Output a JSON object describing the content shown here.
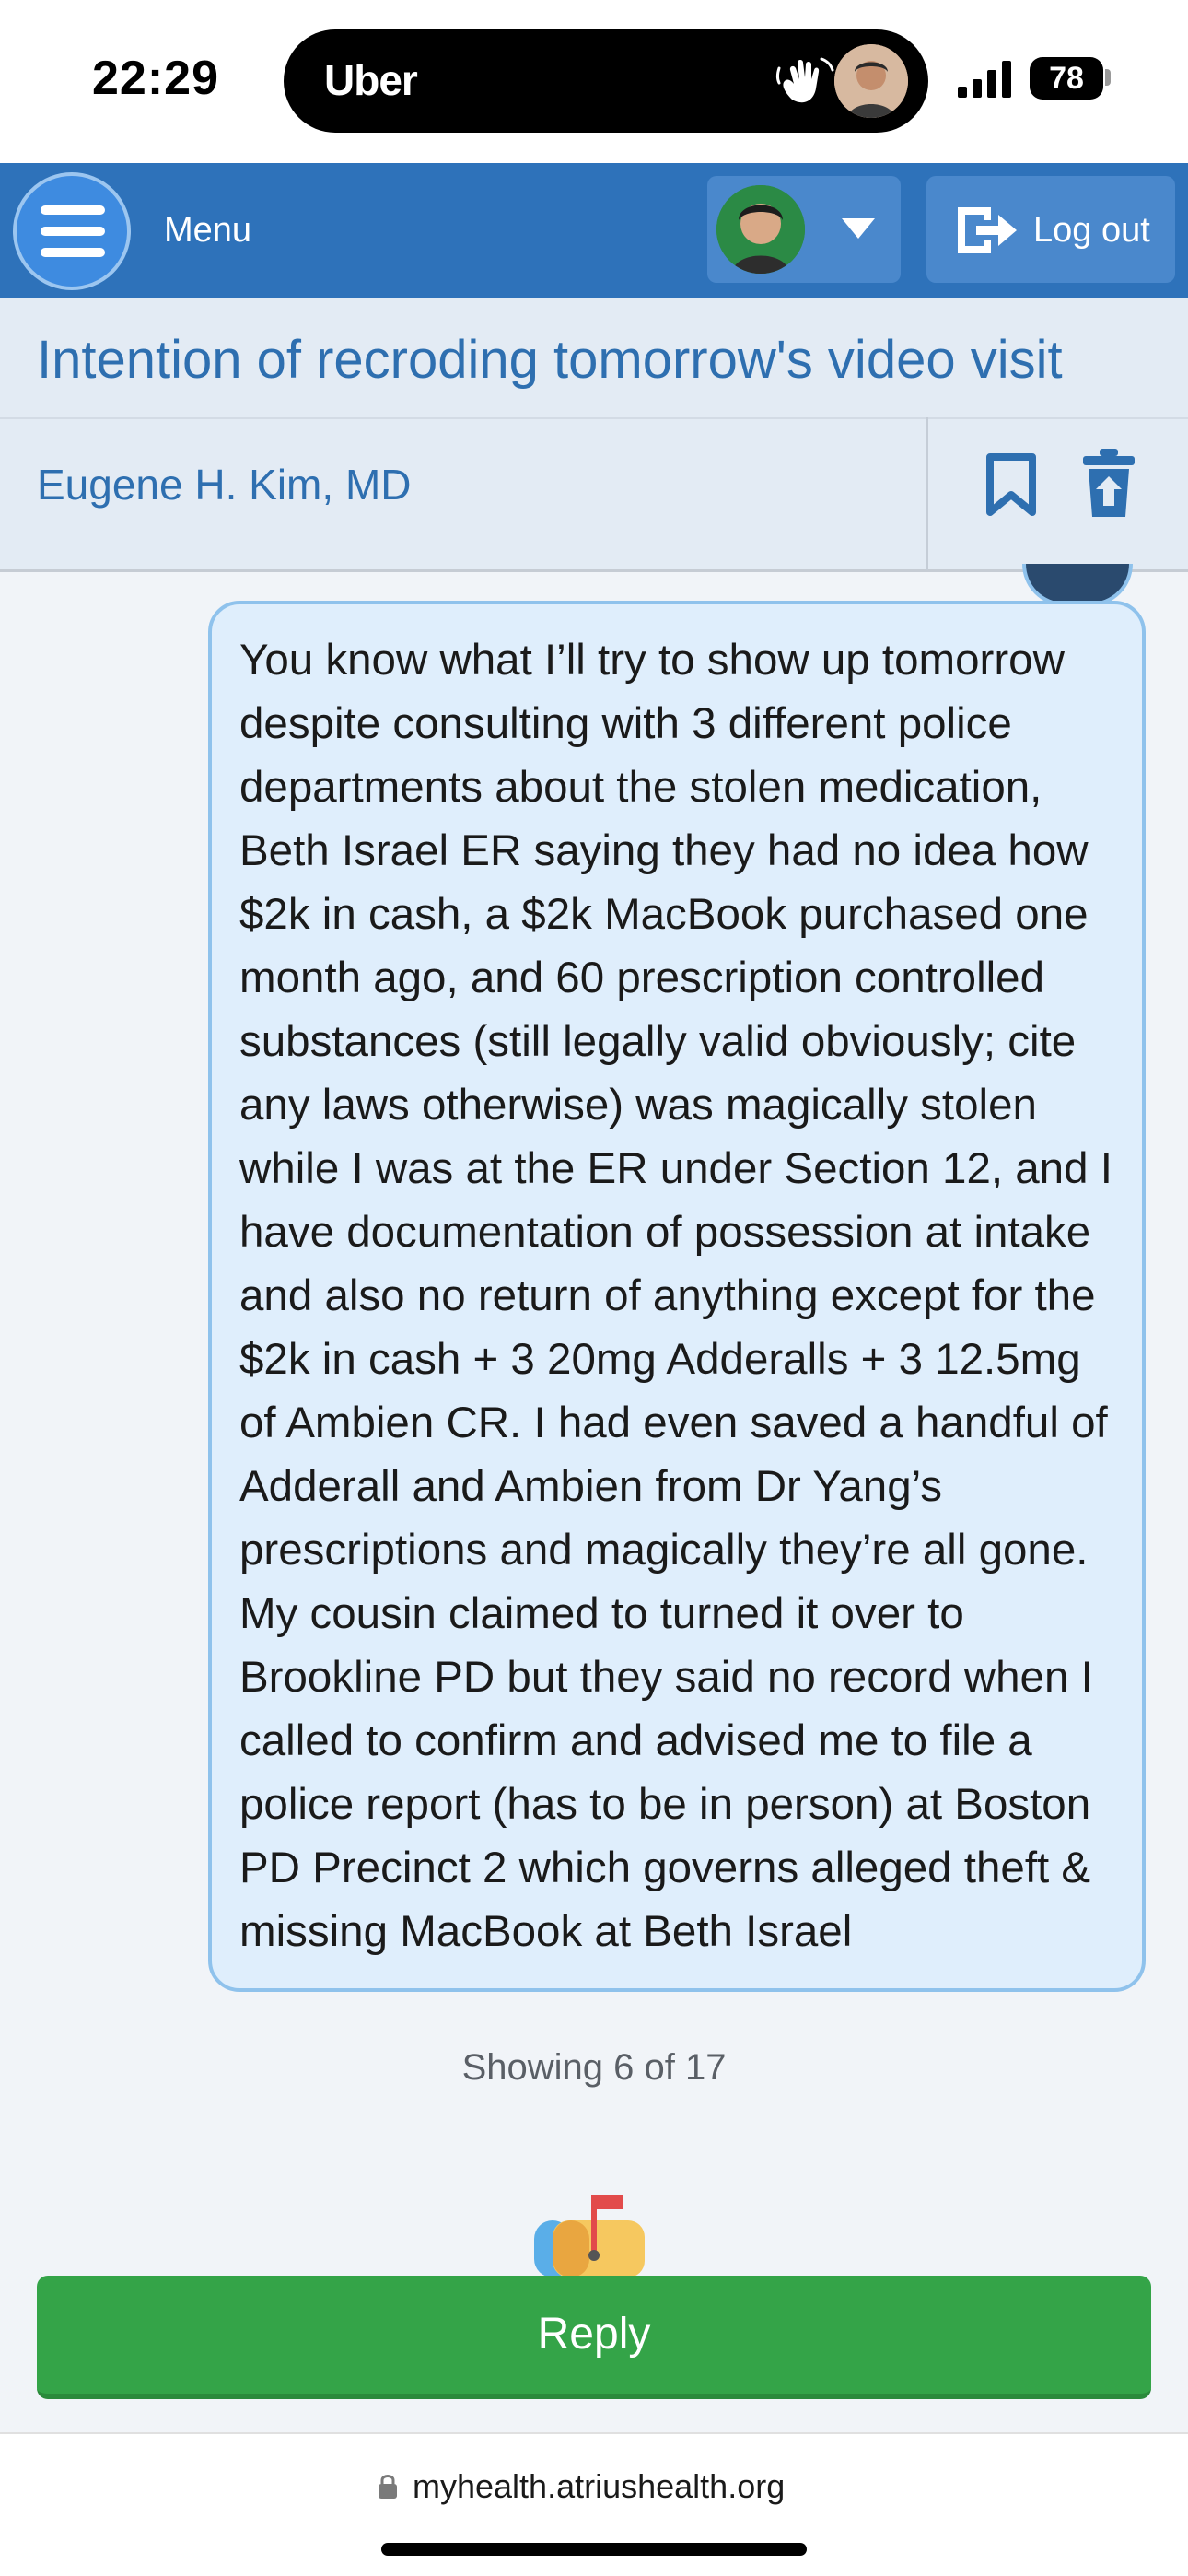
{
  "status_bar": {
    "time": "22:29",
    "live_activity_app": "Uber",
    "live_activity_icon": "wave-hand-icon",
    "signal_icon": "cellular-signal-icon",
    "battery_level": "78"
  },
  "header": {
    "menu_label": "Menu",
    "menu_icon": "hamburger-icon",
    "account_icon": "caret-down-icon",
    "logout_label": "Log out",
    "logout_icon": "logout-icon",
    "brand_color": "#2e72ba"
  },
  "message": {
    "subject": "Intention of recroding tomorrow's video visit",
    "provider": "Eugene H. Kim, MD",
    "bookmark_icon": "bookmark-icon",
    "delete_icon": "trash-icon",
    "body": "You know what I’ll try to show up tomorrow despite consulting with 3 different police departments about the stolen medication, Beth Israel ER saying they had no idea how $2k in cash, a $2k MacBook purchased one month ago, and 60 prescription controlled substances (still legally valid obviously; cite any laws otherwise) was magically stolen while I was at the ER under Section 12, and I have documentation of possession at intake and also no return of anything except for the $2k in cash + 3 20mg Adderalls + 3 12.5mg of Ambien CR. I had even saved a handful of Adderall and Ambien from Dr Yang’s prescriptions and magically they’re all gone. My cousin claimed to turned it over to Brookline PD but they said no record when I called to confirm and advised me to file a police report (has to be in person) at Boston PD Precinct 2 which governs alleged theft & missing MacBook at Beth Israel"
  },
  "pagination": {
    "showing": "Showing 6 of 17"
  },
  "reply": {
    "label": "Reply",
    "color": "#34a448"
  },
  "browser": {
    "url": "myhealth.atriushealth.org"
  }
}
